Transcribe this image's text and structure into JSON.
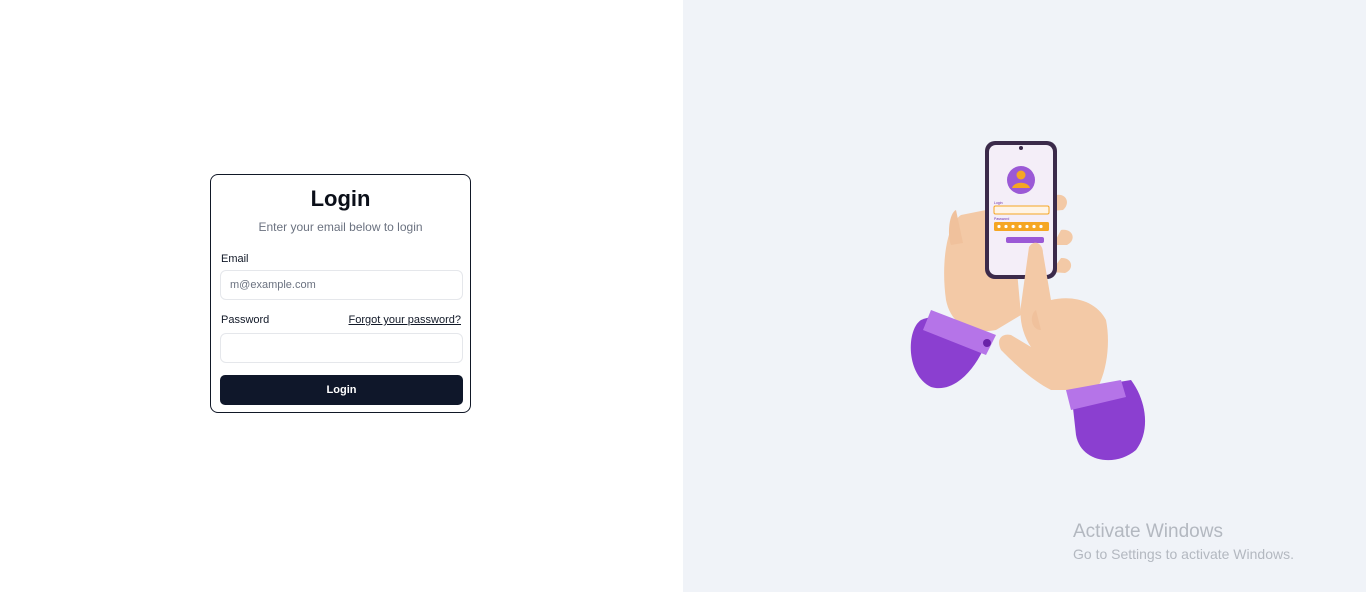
{
  "login": {
    "title": "Login",
    "subtitle": "Enter your email below to login",
    "email_label": "Email",
    "email_placeholder": "m@example.com",
    "email_value": "",
    "password_label": "Password",
    "forgot_link": "Forgot your password?",
    "password_value": "",
    "submit_label": "Login"
  },
  "illustration": {
    "phone_login_label": "Login",
    "phone_password_label": "Password",
    "colors": {
      "sleeve": "#8b3fd0",
      "skin": "#f3c9a6",
      "accent": "#f5a623",
      "phone_frame": "#3b2a4a"
    }
  },
  "watermark": {
    "title": "Activate Windows",
    "subtitle": "Go to Settings to activate Windows."
  },
  "colors": {
    "right_panel_bg": "#f0f3f8",
    "button_bg": "#0f172a"
  }
}
